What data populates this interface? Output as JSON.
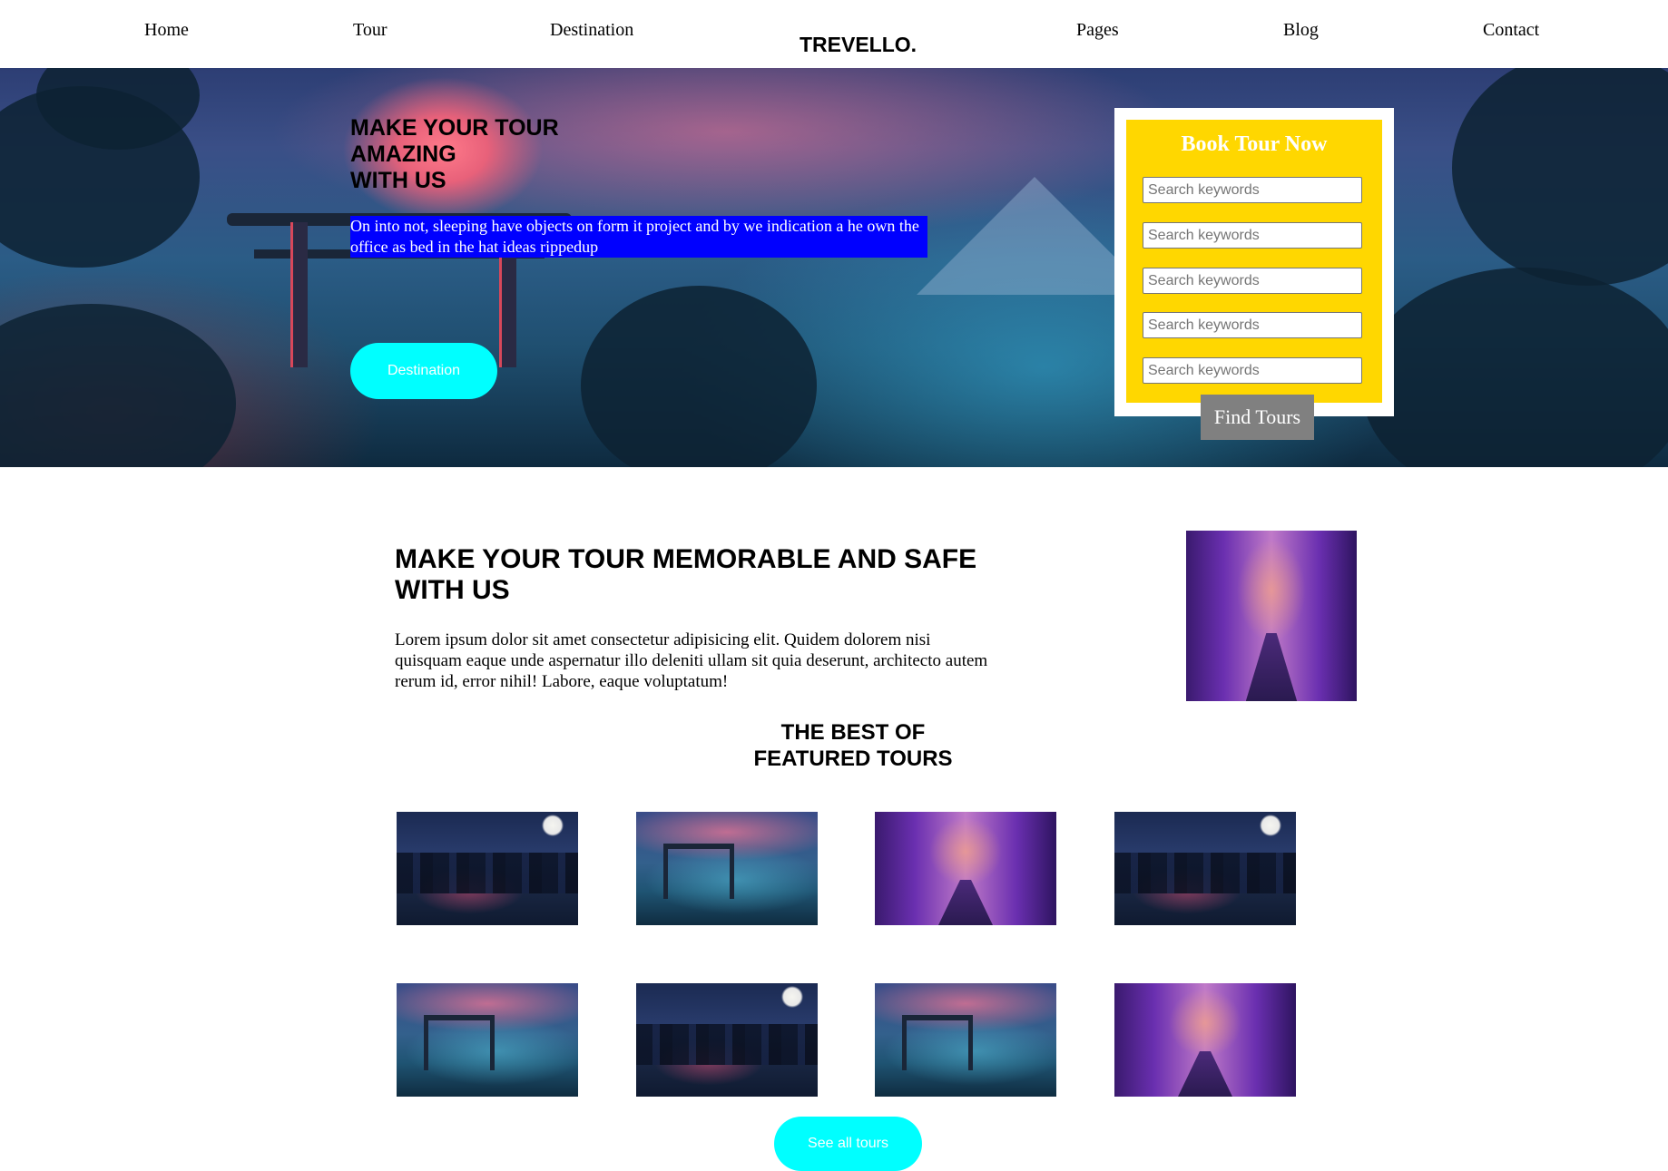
{
  "nav": {
    "items": [
      "Home",
      "Tour",
      "Destination",
      "Pages",
      "Blog",
      "Contact"
    ],
    "brand": "TREVELLO."
  },
  "hero": {
    "title": "MAKE YOUR TOUR\nAMAZING\nWITH US",
    "subtitle": "On into not, sleeping have objects on form it project and by we indication a he own the office as bed in the hat ideas rippedup",
    "button": "Destination"
  },
  "booking": {
    "title": "Book Tour Now",
    "fields": [
      {
        "placeholder": "Search keywords"
      },
      {
        "placeholder": "Search keywords"
      },
      {
        "placeholder": "Search keywords"
      },
      {
        "placeholder": "Search keywords"
      },
      {
        "placeholder": "Search keywords"
      }
    ],
    "submit": "Find Tours"
  },
  "about": {
    "title": "MAKE YOUR TOUR MEMORABLE AND SAFE WITH US",
    "text": "Lorem ipsum dolor sit amet consectetur adipisicing elit. Quidem dolorem nisi quisquam eaque unde aspernatur illo deleniti ullam sit quia deserunt, architecto autem rerum id, error nihil! Labore, eaque voluptatum!"
  },
  "featured": {
    "title": "THE BEST OF\nFEATURED TOURS",
    "button": "See all tours"
  },
  "colors": {
    "accent_cyan": "#00ffff",
    "booking_yellow": "#ffd700",
    "highlight_blue": "#0000ff",
    "button_gray": "#808080"
  }
}
